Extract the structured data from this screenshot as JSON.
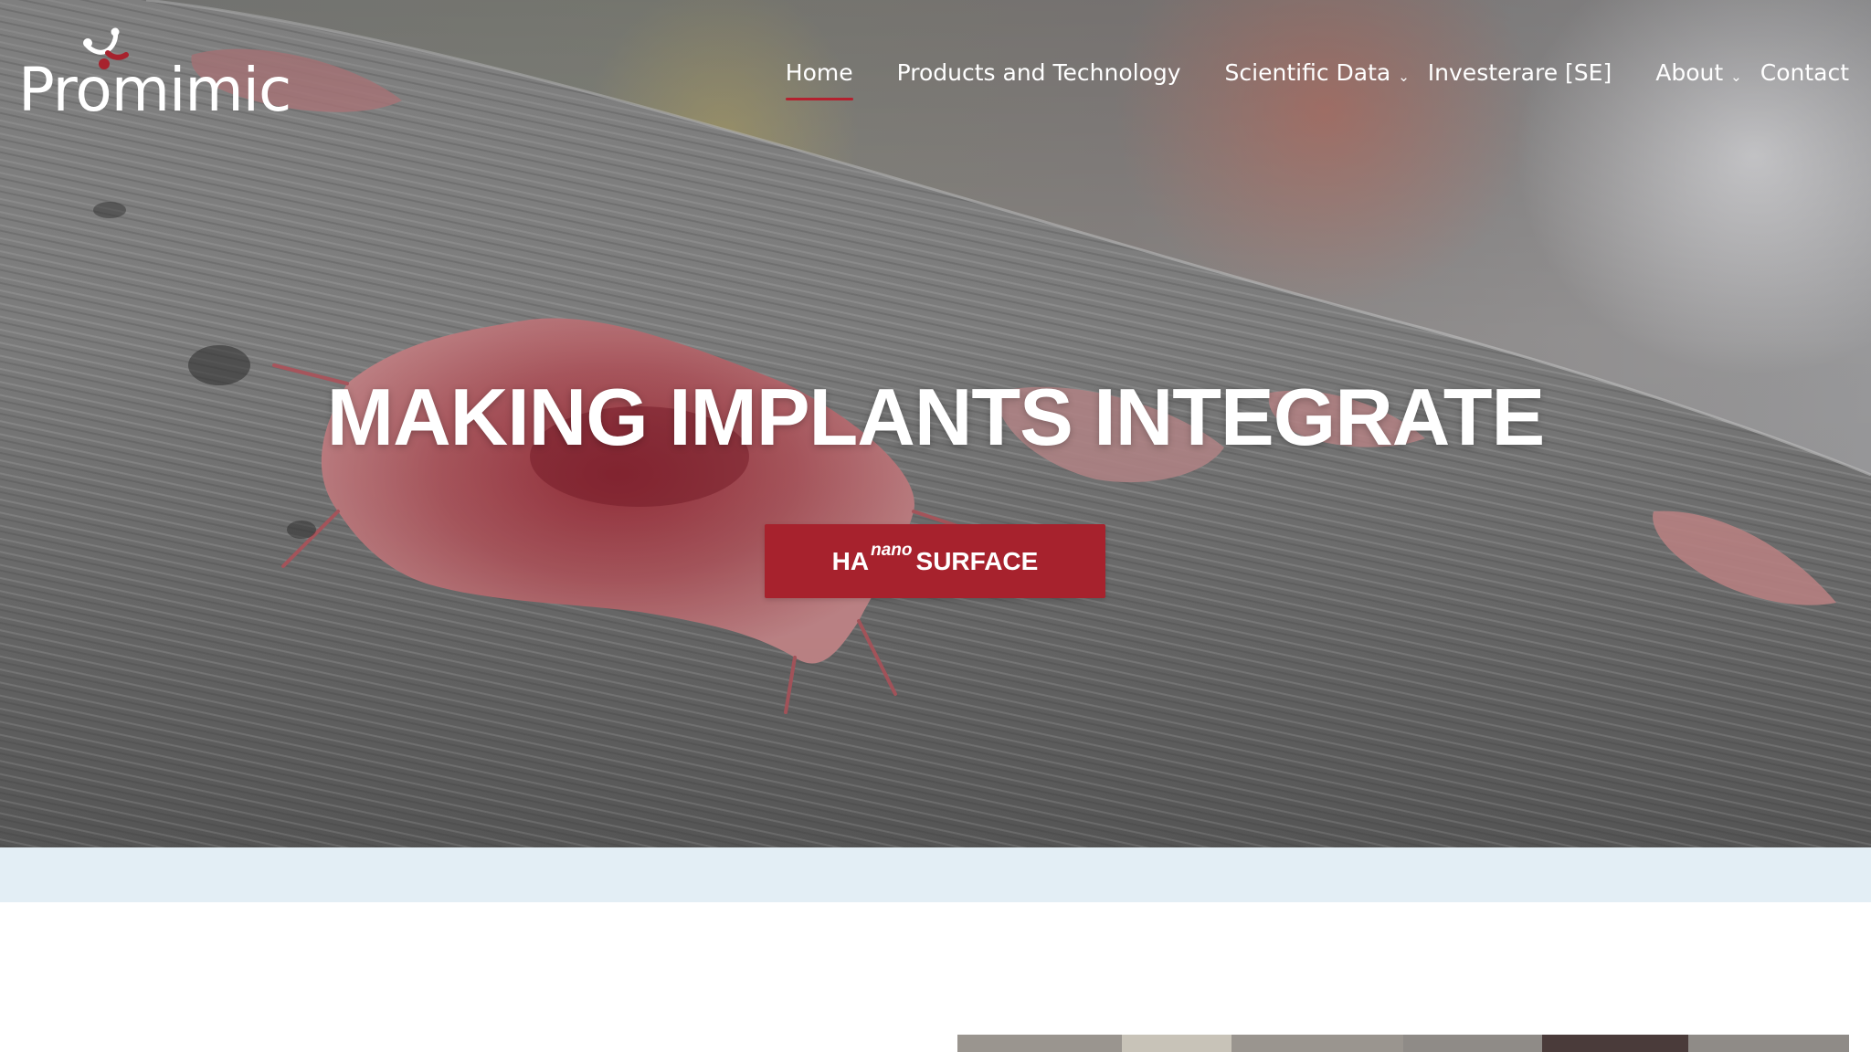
{
  "brand": {
    "name": "Promimic",
    "logo_mark_color": "#a7222d"
  },
  "nav": {
    "items": [
      {
        "label": "Home",
        "active": true,
        "has_dropdown": false
      },
      {
        "label": "Products and Technology",
        "active": false,
        "has_dropdown": false
      },
      {
        "label": "Scientific Data",
        "active": false,
        "has_dropdown": true
      },
      {
        "label": "Investerare [SE]",
        "active": false,
        "has_dropdown": false
      },
      {
        "label": "About",
        "active": false,
        "has_dropdown": true
      },
      {
        "label": "Contact",
        "active": false,
        "has_dropdown": false
      }
    ],
    "dropdown_icon": "chevron-down-icon",
    "active_underline_color": "#b3212e"
  },
  "hero": {
    "title": "MAKING IMPLANTS INTEGRATE",
    "background": "microscope image of a red cell on an implant surface",
    "cta": {
      "prefix": "HA",
      "superscript": "nano",
      "suffix": "SURFACE",
      "color": "#a7222d"
    }
  },
  "band": {
    "color": "#e3eef5"
  }
}
